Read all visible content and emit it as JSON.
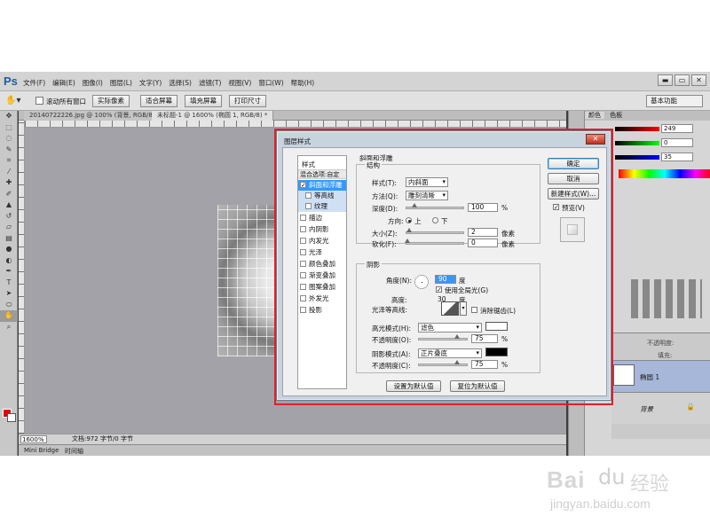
{
  "app": {
    "logo": "Ps",
    "menus": [
      "文件(F)",
      "编辑(E)",
      "图像(I)",
      "图层(L)",
      "文字(Y)",
      "选择(S)",
      "滤镜(T)",
      "视图(V)",
      "窗口(W)",
      "帮助(H)"
    ],
    "window_controls": [
      "▬",
      "▭",
      "✕"
    ]
  },
  "options_bar": {
    "scroll_all_label": "滚动所有窗口",
    "buttons": [
      "实际像素",
      "适合屏幕",
      "填充屏幕",
      "打印尺寸"
    ],
    "workspace": "基本功能"
  },
  "document": {
    "tabs": [
      "20140722226.jpg @ 100% (背景, RGB/8) *",
      "未标题-1 @ 1600% (椭圆 1, RGB/8) *"
    ],
    "zoom": "1600%",
    "doc_info": "文档:972 字节/0 字节",
    "bottom_tabs": [
      "Mini Bridge",
      "时间轴"
    ]
  },
  "panels": {
    "color_tabs": [
      "颜色",
      "色板"
    ],
    "color_values": [
      "249",
      "0",
      "35"
    ],
    "layers": {
      "opacity_label": "不透明度:",
      "fill_label": "填充:",
      "layer_1": "椭圆 1",
      "layer_bg": "背景"
    }
  },
  "dialog": {
    "title": "图层样式",
    "styles_header": "样式",
    "blend_options": "混合选项:自定",
    "style_items": [
      {
        "label": "斜面和浮雕",
        "checked": true
      },
      {
        "label": "等高线",
        "checked": false
      },
      {
        "label": "纹理",
        "checked": false
      },
      {
        "label": "描边",
        "checked": false
      },
      {
        "label": "内阴影",
        "checked": false
      },
      {
        "label": "内发光",
        "checked": false
      },
      {
        "label": "光泽",
        "checked": false
      },
      {
        "label": "颜色叠加",
        "checked": false
      },
      {
        "label": "渐变叠加",
        "checked": false
      },
      {
        "label": "图案叠加",
        "checked": false
      },
      {
        "label": "外发光",
        "checked": false
      },
      {
        "label": "投影",
        "checked": false
      }
    ],
    "bevel": {
      "section_title": "斜面和浮雕",
      "structure_title": "结构",
      "style_label": "样式(T):",
      "style_value": "内斜面",
      "technique_label": "方法(Q):",
      "technique_value": "雕刻清晰",
      "depth_label": "深度(D):",
      "depth_value": "100",
      "depth_unit": "%",
      "direction_label": "方向:",
      "direction_up": "上",
      "direction_down": "下",
      "size_label": "大小(Z):",
      "size_value": "2",
      "size_unit": "像素",
      "soften_label": "软化(F):",
      "soften_value": "0",
      "soften_unit": "像素"
    },
    "shading": {
      "title": "阴影",
      "angle_label": "角度(N):",
      "angle_value": "90",
      "angle_unit": "度",
      "global_light": "使用全局光(G)",
      "altitude_label": "高度:",
      "altitude_value": "30",
      "altitude_unit": "度",
      "gloss_label": "光泽等高线:",
      "antialias": "消除锯齿(L)",
      "highlight_mode_label": "高光模式(H):",
      "highlight_mode": "滤色",
      "highlight_opacity_label": "不透明度(O):",
      "highlight_opacity": "75",
      "shadow_mode_label": "阴影模式(A):",
      "shadow_mode": "正片叠底",
      "shadow_opacity_label": "不透明度(C):",
      "shadow_opacity": "75",
      "percent": "%"
    },
    "buttons": {
      "make_default": "设置为默认值",
      "reset_default": "复位为默认值",
      "ok": "确定",
      "cancel": "取消",
      "new_style": "新建样式(W)...",
      "preview": "预览(V)"
    }
  },
  "watermark": {
    "logo": "Bai",
    "paw": "du",
    "jingyan": "经验",
    "url": "jingyan.baidu.com"
  },
  "colors": {
    "highlight_outline": "#e0202a",
    "selected_style": "#3399ff",
    "foreground": "#e00000"
  }
}
